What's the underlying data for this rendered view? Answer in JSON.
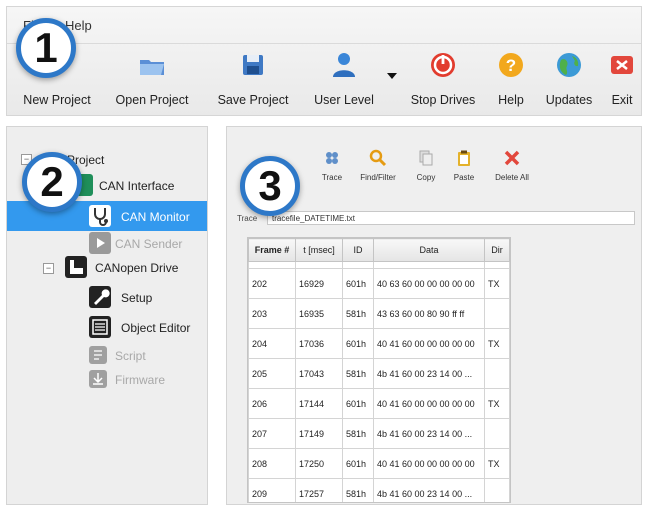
{
  "menu": {
    "file": "File",
    "help": "Help"
  },
  "toolbar": [
    {
      "label": "New Project",
      "icon": "new-project-icon"
    },
    {
      "label": "Open Project",
      "icon": "folder-open-icon"
    },
    {
      "label": "Save Project",
      "icon": "save-disk-icon"
    },
    {
      "label": "User Level",
      "icon": "user-icon"
    },
    {
      "label": "Stop Drives",
      "icon": "stop-icon"
    },
    {
      "label": "Help",
      "icon": "help-icon"
    },
    {
      "label": "Updates",
      "icon": "globe-icon"
    },
    {
      "label": "Exit",
      "icon": "exit-icon"
    }
  ],
  "badges": [
    "1",
    "2",
    "3"
  ],
  "tree": {
    "root": "Project",
    "items": [
      {
        "label": "CAN Interface"
      },
      {
        "label": "CAN Monitor",
        "selected": true
      },
      {
        "label": "CAN Sender",
        "disabled": true
      },
      {
        "label": "CANopen Drive"
      },
      {
        "label": "Setup"
      },
      {
        "label": "Object Editor"
      },
      {
        "label": "Script",
        "disabled": true
      },
      {
        "label": "Firmware",
        "disabled": true
      }
    ]
  },
  "monitor": {
    "tools": [
      {
        "label": "Trace",
        "icon": "trace-icon"
      },
      {
        "label": "Find/Filter",
        "icon": "magnifier-icon"
      },
      {
        "label": "Copy",
        "icon": "copy-icon"
      },
      {
        "label": "Paste",
        "icon": "paste-icon"
      },
      {
        "label": "Delete All",
        "icon": "delete-icon"
      }
    ],
    "trace_label": "Trace",
    "trace_value": "tracefile_DATETIME.txt",
    "columns": [
      "Frame #",
      "t [msec]",
      "ID",
      "Data",
      "Dir"
    ],
    "rows": [
      {
        "frame": "202",
        "t": "16929",
        "id": "601h",
        "data": "40 63 60 00 00 00 00 00",
        "dir": "TX"
      },
      {
        "frame": "203",
        "t": "16935",
        "id": "581h",
        "data": "43 63 60 00 80 90 ff ff",
        "dir": ""
      },
      {
        "frame": "204",
        "t": "17036",
        "id": "601h",
        "data": "40 41 60 00 00 00 00 00",
        "dir": "TX"
      },
      {
        "frame": "205",
        "t": "17043",
        "id": "581h",
        "data": "4b 41 60 00 23 14 00 ...",
        "dir": ""
      },
      {
        "frame": "206",
        "t": "17144",
        "id": "601h",
        "data": "40 41 60 00 00 00 00 00",
        "dir": "TX"
      },
      {
        "frame": "207",
        "t": "17149",
        "id": "581h",
        "data": "4b 41 60 00 23 14 00 ...",
        "dir": ""
      },
      {
        "frame": "208",
        "t": "17250",
        "id": "601h",
        "data": "40 41 60 00 00 00 00 00",
        "dir": "TX"
      },
      {
        "frame": "209",
        "t": "17257",
        "id": "581h",
        "data": "4b 41 60 00 23 14 00 ...",
        "dir": ""
      }
    ]
  }
}
